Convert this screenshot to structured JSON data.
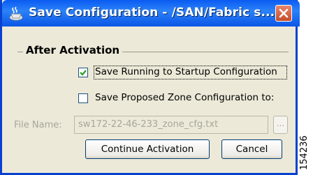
{
  "window": {
    "title": "Save Configuration - /SAN/Fabric s...",
    "icon": "java-cup-icon",
    "close_icon": "close-icon"
  },
  "group": {
    "title": "After Activation",
    "options": [
      {
        "label": "Save Running to Startup Configuration",
        "checked": true
      },
      {
        "label": "Save Proposed Zone Configuration to:",
        "checked": false
      }
    ]
  },
  "file": {
    "label": "File Name:",
    "value": "sw172-22-46-233_zone_cfg.txt",
    "browse_label": "...",
    "disabled": true
  },
  "buttons": {
    "continue_label": "Continue Activation",
    "cancel_label": "Cancel"
  },
  "figure_id": "154236",
  "colors": {
    "titlebar": "#0a5bf2",
    "close_button": "#d6593a",
    "dialog_bg": "#ece9d8",
    "check_mark": "#21a121"
  }
}
